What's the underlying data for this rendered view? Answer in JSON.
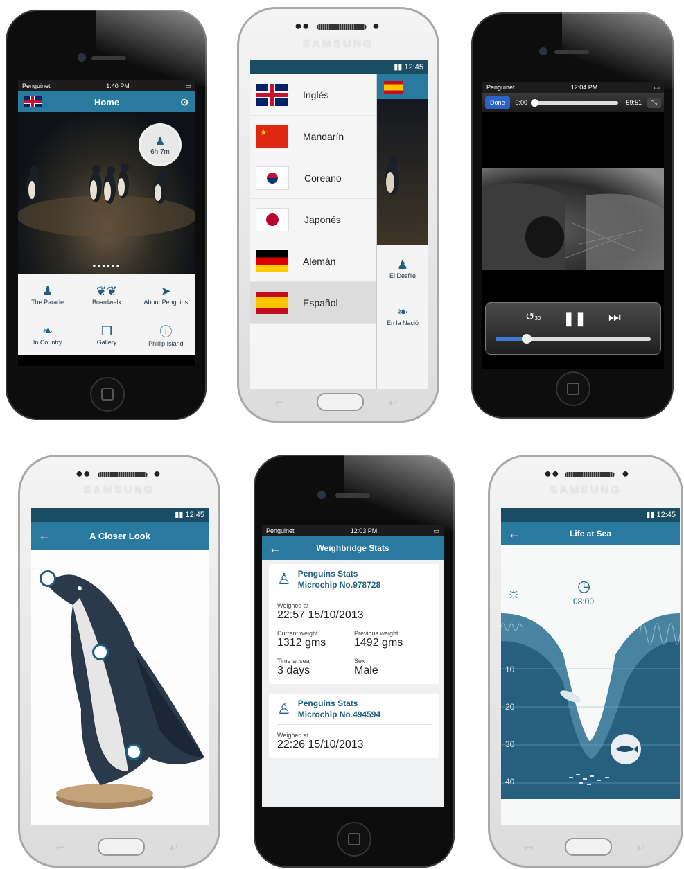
{
  "phone1": {
    "status": {
      "carrier": "Penguinet",
      "time": "1:40 PM"
    },
    "header_title": "Home",
    "timer": "6h 7m",
    "grid": [
      {
        "label": "The Parade",
        "icon": "penguin-icon"
      },
      {
        "label": "Boardwalk",
        "icon": "footprints-icon"
      },
      {
        "label": "About Penguins",
        "icon": "swimming-penguin-icon"
      },
      {
        "label": "In Country",
        "icon": "leaf-icon"
      },
      {
        "label": "Gallery",
        "icon": "gallery-icon"
      },
      {
        "label": "Phillip Island",
        "icon": "info-icon"
      }
    ]
  },
  "phone2": {
    "brand": "SAMSUNG",
    "status_time": "12:45",
    "languages": [
      {
        "label": "Inglés",
        "flag": "uk"
      },
      {
        "label": "Mandarín",
        "flag": "china"
      },
      {
        "label": "Coreano",
        "flag": "korea"
      },
      {
        "label": "Japonés",
        "flag": "japan"
      },
      {
        "label": "Alemán",
        "flag": "germany"
      },
      {
        "label": "Español",
        "flag": "spain"
      }
    ],
    "side_items": [
      "El Desfile",
      "En la Nació"
    ]
  },
  "phone3": {
    "status": {
      "carrier": "Penguinet",
      "time": "12:04 PM"
    },
    "done_label": "Done",
    "time_elapsed": "0:00",
    "time_remaining": "-59:51",
    "skip_label": "30",
    "progress": 0.2
  },
  "phone4": {
    "brand": "SAMSUNG",
    "status_time": "12:45",
    "title": "A Closer Look"
  },
  "phone5": {
    "status": {
      "carrier": "Penguinet",
      "time": "12:03 PM"
    },
    "title": "Weighbridge Stats",
    "cards": [
      {
        "title": "Penguins Stats",
        "microchip": "Microchip No.978728",
        "weighed_label": "Weighed at",
        "weighed_value": "22:57 15/10/2013",
        "current_weight_label": "Current weight",
        "current_weight": "1312 gms",
        "previous_weight_label": "Previous weight",
        "previous_weight": "1492 gms",
        "time_at_sea_label": "Time at sea",
        "time_at_sea": "3 days",
        "sex_label": "Sex",
        "sex": "Male"
      },
      {
        "title": "Penguins Stats",
        "microchip": "Microchip No.494594",
        "weighed_label": "Weighed at",
        "weighed_value": "22:26 15/10/2013"
      }
    ]
  },
  "phone6": {
    "brand": "SAMSUNG",
    "status_time": "12:45",
    "title": "Life at Sea",
    "clock_time": "08:00",
    "depths": [
      "10",
      "20",
      "30",
      "40"
    ]
  },
  "colors": {
    "accent": "#2a7aa0",
    "status_dark": "#1a4c63",
    "sea": "#1d4f6c"
  }
}
